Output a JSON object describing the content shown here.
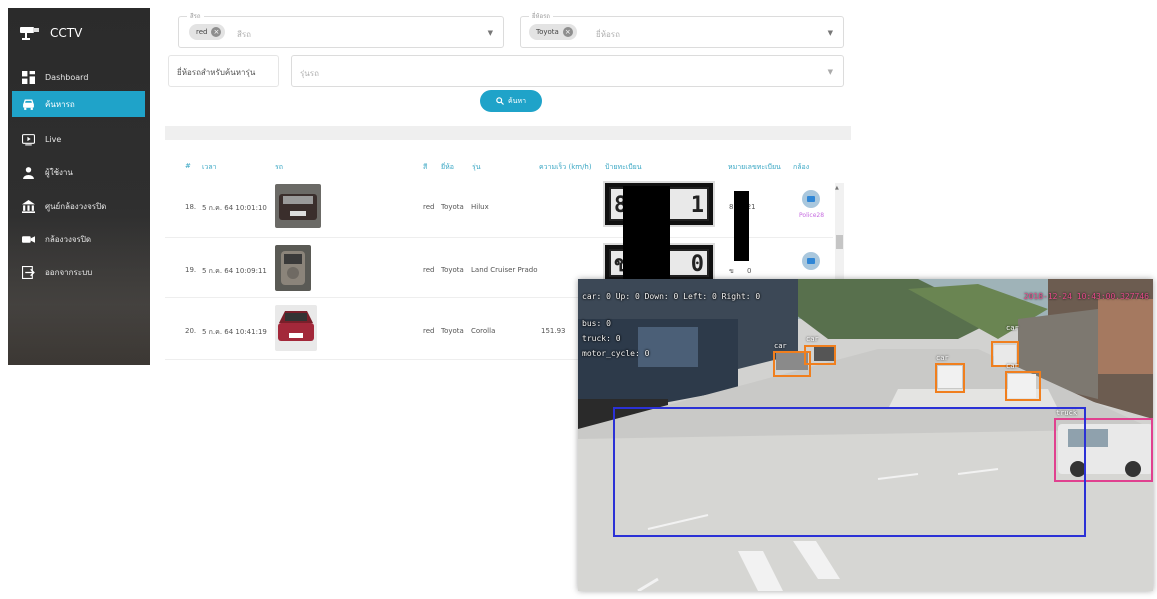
{
  "app": {
    "title": "CCTV"
  },
  "sidebar": {
    "items": [
      {
        "label": "Dashboard",
        "icon": "dashboard-icon"
      },
      {
        "label": "ค้นหารถ",
        "icon": "car-icon",
        "active": true
      },
      {
        "label": "Live",
        "icon": "live-icon"
      },
      {
        "label": "ผู้ใช้งาน",
        "icon": "user-icon"
      },
      {
        "label": "ศูนย์กล้องวงจรปิด",
        "icon": "building-icon"
      },
      {
        "label": "กล้องวงจรปิด",
        "icon": "camera-icon"
      },
      {
        "label": "ออกจากระบบ",
        "icon": "logout-icon"
      }
    ],
    "accent": "#1fa3c9"
  },
  "filters": {
    "color": {
      "label": "สีรถ",
      "chip": "red",
      "placeholder": "สีรถ"
    },
    "brand": {
      "label": "ยี่ห้อรถ",
      "chip": "Toyota",
      "placeholder": "ยี่ห้อรถ"
    },
    "brand_select": {
      "value": "ยี่ห้อรถสำหรับค้นหารุ่น"
    },
    "model": {
      "placeholder": "รุ่นรถ"
    },
    "search_button": "ค้นหา"
  },
  "table": {
    "headers": [
      "#",
      "เวลา",
      "รถ",
      "สี",
      "ยี่ห้อ",
      "รุ่น",
      "ความเร็ว (km/h)",
      "ป้ายทะเบียน",
      "หมายเลขทะเบียน",
      "กล้อง"
    ],
    "rows": [
      {
        "index": "18.",
        "time": "5 ก.ค. 64 10:01:10",
        "color": "red",
        "brand": "Toyota",
        "model": "Hilux",
        "speed": "",
        "plate_text": "8",
        "plate_text_right": "1",
        "plate_number": "8",
        "plate_number_right": "21",
        "camera": "Police28"
      },
      {
        "index": "19.",
        "time": "5 ก.ค. 64 10:09:11",
        "color": "red",
        "brand": "Toyota",
        "model": "Land Cruiser Prado",
        "speed": "",
        "plate_text": "ข",
        "plate_text_right": "0",
        "plate_number": "ข",
        "plate_number_right": "0",
        "camera": ""
      },
      {
        "index": "20.",
        "time": "5 ก.ค. 64 10:41:19",
        "color": "red",
        "brand": "Toyota",
        "model": "Corolla",
        "speed": "151.93",
        "plate_text": "",
        "plate_text_right": "",
        "plate_number": "",
        "plate_number_right": "",
        "camera": ""
      }
    ]
  },
  "camera_feed": {
    "stats_line1": "car: 0   Up: 0 Down: 0 Left: 0 Right: 0",
    "stats_bus": "bus: 0",
    "stats_truck": "truck: 0",
    "stats_moto": "motor_cycle: 0",
    "timestamp": "2018-12-24 10:43:00.327746",
    "detections": [
      "car",
      "car",
      "car",
      "car",
      "car",
      "truck"
    ]
  }
}
